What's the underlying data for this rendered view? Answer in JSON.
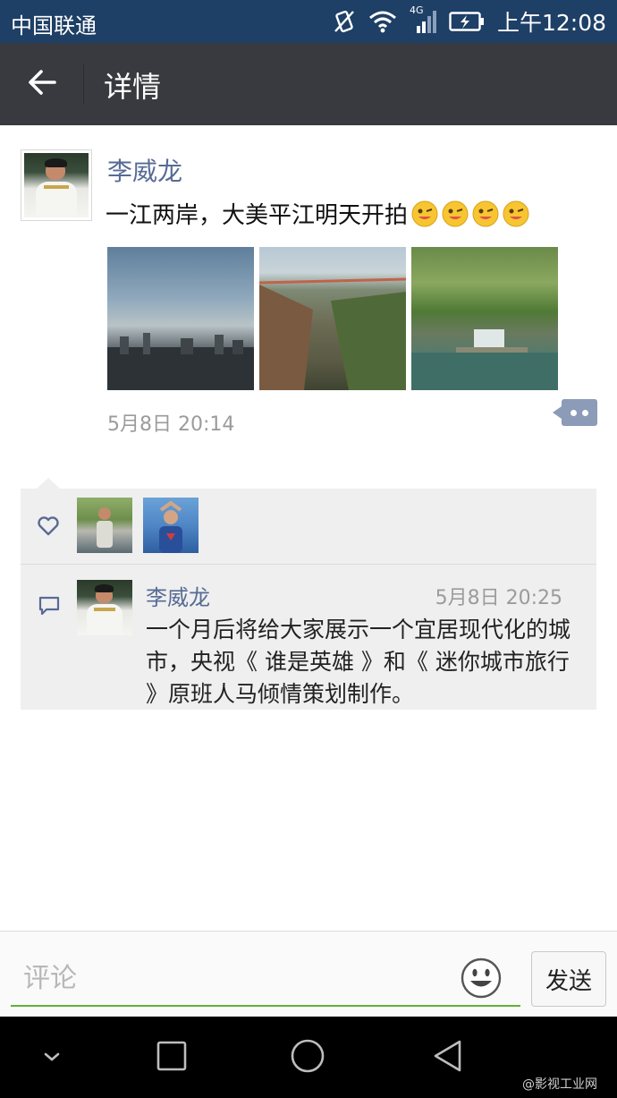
{
  "status_bar": {
    "carrier": "中国联通",
    "network": "4G",
    "time": "上午12:08"
  },
  "header": {
    "title": "详情",
    "back_icon": "arrow-left-icon"
  },
  "post": {
    "author": "李威龙",
    "text": "一江两岸，大美平江明天开拍",
    "emoji_count": 4,
    "photos": [
      {
        "name": "city-skyline-photo"
      },
      {
        "name": "cliff-bridge-photo"
      },
      {
        "name": "waterfall-photo"
      }
    ],
    "time": "5月8日 20:14"
  },
  "likes": {
    "icon": "heart-icon",
    "count": 2
  },
  "comment": {
    "icon": "comment-bubble-icon",
    "author": "李威龙",
    "time": "5月8日 20:25",
    "text": "一个月后将给大家展示一个宜居现代化的城市，央视《 谁是英雄 》和《 迷你城市旅行 》原班人马倾情策划制作。"
  },
  "input_bar": {
    "placeholder": "评论",
    "send_label": "发送"
  },
  "watermark": "@影视工业网",
  "colors": {
    "status_bar": "#1e3f66",
    "title_bar": "#393a3f",
    "link_name": "#576b95",
    "input_underline": "#5fb236"
  }
}
